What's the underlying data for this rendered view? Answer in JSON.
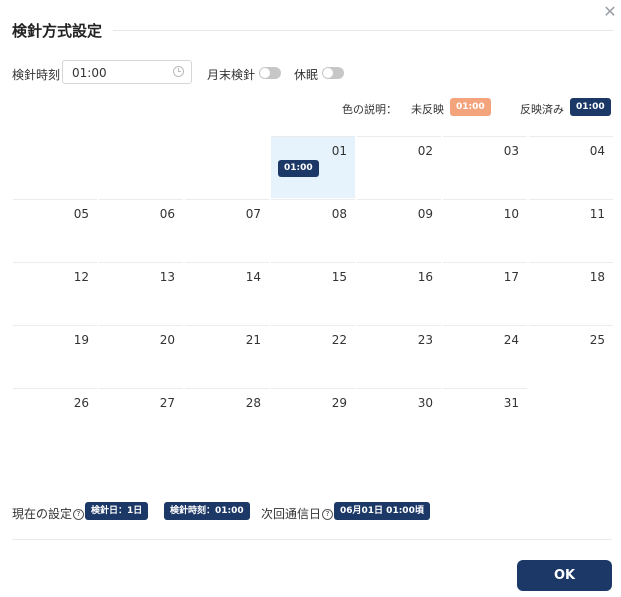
{
  "dialog": {
    "title": "検針方式設定"
  },
  "settings": {
    "time_label": "検針時刻",
    "time_value": "01:00",
    "month_end_label": "月末検針",
    "dormant_label": "休眠"
  },
  "legend": {
    "title": "色の説明：",
    "unreflected_label": "未反映",
    "unreflected_badge": "01:00",
    "reflected_label": "反映済み",
    "reflected_badge": "01:00",
    "colors": {
      "unreflected": "#f4a47c",
      "reflected": "#1c3867"
    }
  },
  "calendar": {
    "selected_day": "01",
    "selected_chip": "01:00",
    "days": [
      "01",
      "02",
      "03",
      "04",
      "05",
      "06",
      "07",
      "08",
      "09",
      "10",
      "11",
      "12",
      "13",
      "14",
      "15",
      "16",
      "17",
      "18",
      "19",
      "20",
      "21",
      "22",
      "23",
      "24",
      "25",
      "26",
      "27",
      "28",
      "29",
      "30",
      "31"
    ]
  },
  "footer": {
    "current_label": "現在の設定",
    "badge_day": "検針日：1日",
    "badge_time": "検針時刻：01:00",
    "next_label": "次回通信日",
    "next_badge": "06月01日 01:00頃",
    "ok_label": "OK"
  }
}
